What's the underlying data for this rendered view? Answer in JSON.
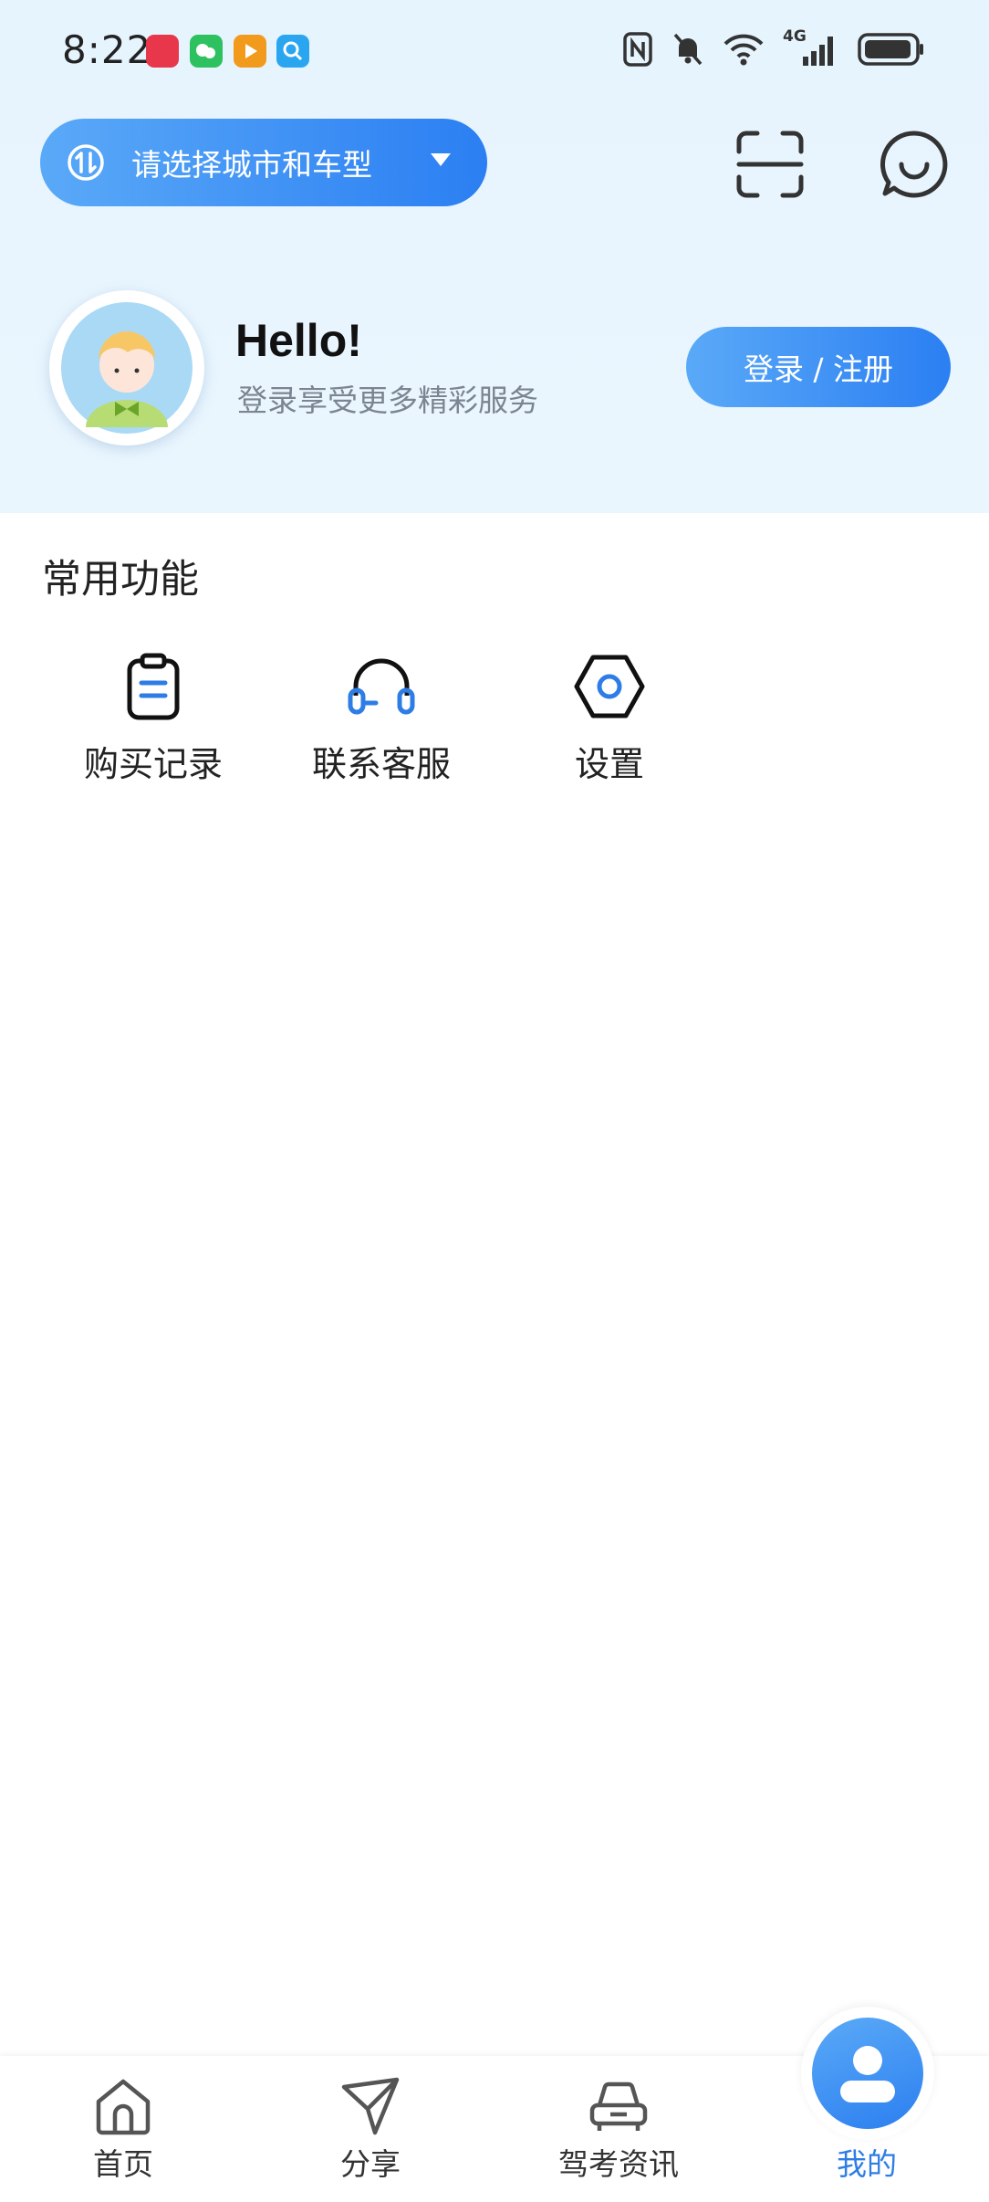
{
  "status_bar": {
    "time": "8:22",
    "network": "4G",
    "app_badges": [
      {
        "name": "huawei-store-icon",
        "color": "#e8364a"
      },
      {
        "name": "wechat-icon",
        "color": "#2ec15f"
      },
      {
        "name": "video-app-icon",
        "color": "#f29a1c"
      },
      {
        "name": "search-app-icon",
        "color": "#2aa6f0"
      }
    ]
  },
  "header": {
    "city_selector_label": "请选择城市和车型",
    "scan_icon": "scan-icon",
    "message_icon": "chat-icon"
  },
  "profile": {
    "greeting": "Hello!",
    "subtitle": "登录享受更多精彩服务",
    "login_label": "登录 / 注册"
  },
  "functions": {
    "title": "常用功能",
    "items": [
      {
        "label": "购买记录",
        "icon": "clipboard-icon"
      },
      {
        "label": "联系客服",
        "icon": "headset-icon"
      },
      {
        "label": "设置",
        "icon": "settings-hex-icon"
      }
    ]
  },
  "bottom_nav": {
    "items": [
      {
        "label": "首页",
        "icon": "home-icon"
      },
      {
        "label": "分享",
        "icon": "paper-plane-icon"
      },
      {
        "label": "驾考资讯",
        "icon": "car-icon"
      },
      {
        "label": "我的",
        "icon": "user-icon",
        "active": true
      }
    ]
  },
  "colors": {
    "accent": "#2e7de6",
    "gradient_start": "#5aa9f8",
    "gradient_end": "#2b7ff2",
    "top_background": "#e6f4fe"
  }
}
